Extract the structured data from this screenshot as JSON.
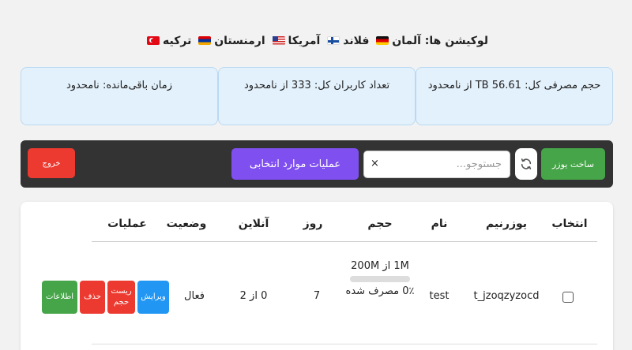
{
  "locations": {
    "label": "لوکیشن ها:",
    "countries": [
      {
        "name": "آلمان",
        "flag": "flag-de"
      },
      {
        "name": "فلاند",
        "flag": "flag-fi"
      },
      {
        "name": "آمریکا",
        "flag": "flag-us"
      },
      {
        "name": "ارمنستان",
        "flag": "flag-am"
      },
      {
        "name": "ترکیه",
        "flag": "flag-tr"
      }
    ]
  },
  "stats": {
    "usage_label": "حجم مصرفی کل:",
    "usage_value": "56.61 TB از نامحدود",
    "users_label": "تعداد کاربران کل:",
    "users_value": "333 از نامحدود",
    "time_label": "زمان باقی‌مانده:",
    "time_value": "نامحدود"
  },
  "toolbar": {
    "create_label": "ساخت یوزر",
    "search_placeholder": "جستوجو...",
    "search_clear": "×",
    "bulk_label": "عملیات موارد انتخابی",
    "logout_label": "خروج"
  },
  "table": {
    "headers": {
      "select": "انتخاب",
      "username": "یوزرنیم",
      "name": "نام",
      "volume": "حجم",
      "days": "روز",
      "online": "آنلاین",
      "status": "وضعیت",
      "actions": "عملیات"
    },
    "rows": [
      {
        "username": "t_jzoqzyzocd",
        "name": "test",
        "volume_text": "1M از 200M",
        "usage_percent": 0,
        "usage_text": "0٪ مصرف شده",
        "days": "7",
        "online": "0 از 2",
        "status": "فعال",
        "actions": {
          "edit": "ویرایش",
          "reset": "ریست حجم",
          "delete": "حذف",
          "info": "اطلاعات"
        }
      }
    ]
  },
  "colors": {
    "green": "#45a548",
    "red": "#ec3a30",
    "blue": "#2196f3",
    "purple": "#7f4ff0"
  }
}
